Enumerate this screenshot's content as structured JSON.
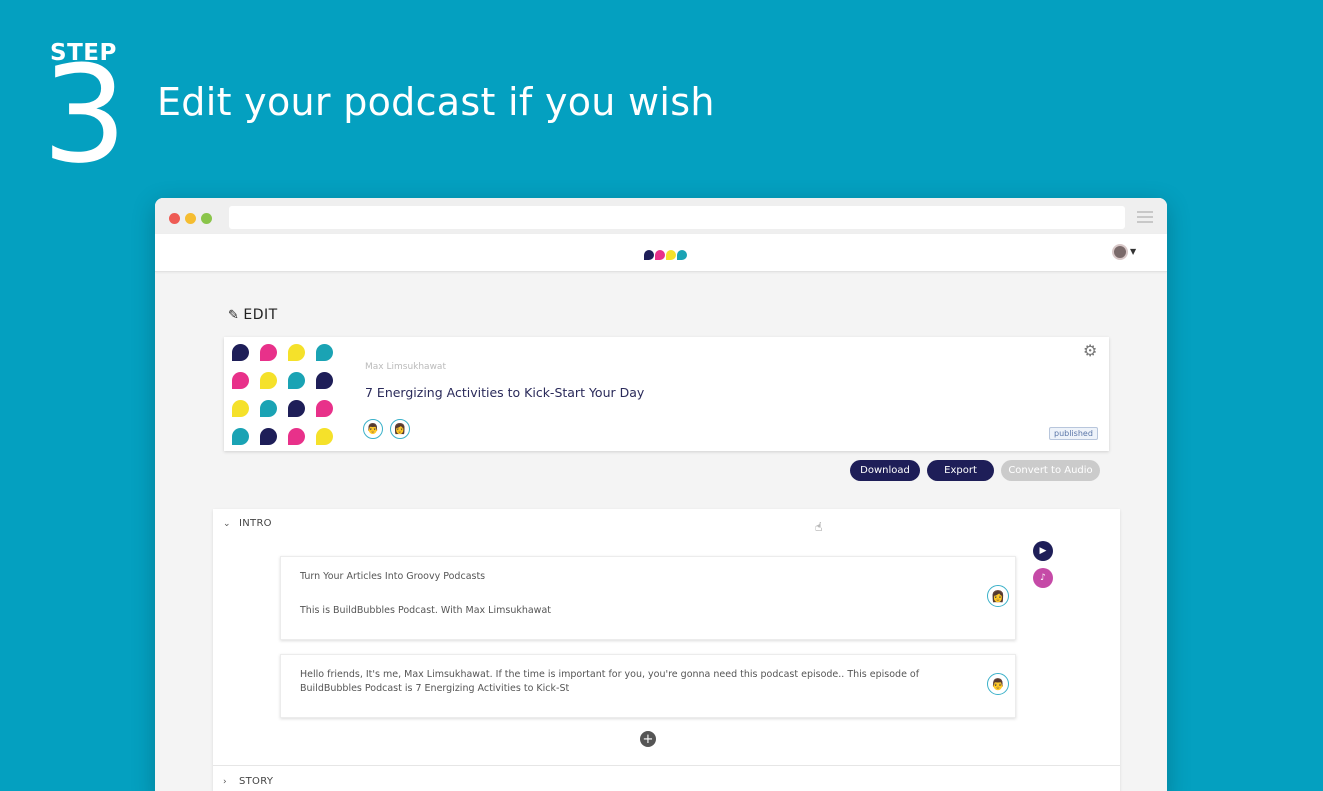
{
  "banner": {
    "step_label": "STEP",
    "step_number": "3",
    "title": "Edit your podcast if you wish"
  },
  "colors": {
    "background": "#04a0c0",
    "navy": "#1e1e58",
    "pink": "#e8318a",
    "yellow": "#f5e12a",
    "teal": "#1aa3b4"
  },
  "logo_colors": [
    "#1e1e58",
    "#e8318a",
    "#f5e12a",
    "#1aa3b4"
  ],
  "bubble_colors": [
    "#1e1e58",
    "#e8318a",
    "#f5e12a",
    "#1aa3b4",
    "#e8318a",
    "#f5e12a",
    "#1aa3b4",
    "#1e1e58",
    "#f5e12a",
    "#1aa3b4",
    "#1e1e58",
    "#e8318a",
    "#1aa3b4",
    "#1e1e58",
    "#e8318a",
    "#f5e12a"
  ],
  "page": {
    "heading": "EDIT",
    "heading_icon": "pencil-icon"
  },
  "podcast": {
    "author": "Max Limsukhawat",
    "title": "7 Energizing Activities to Kick-Start Your Day",
    "status": "published",
    "hosts": [
      "host-avatar-male",
      "host-avatar-female"
    ]
  },
  "actions": {
    "download": "Download",
    "export": "Export",
    "convert": "Convert to Audio"
  },
  "sections": {
    "intro": "INTRO",
    "story": "STORY",
    "blocks": [
      {
        "line1": "Turn Your Articles Into Groovy Podcasts",
        "line2": "This is BuildBubbles Podcast. With Max Limsukhawat"
      },
      {
        "line1": "Hello friends, It's me, Max Limsukhawat. If the time is important for you, you're gonna need this podcast episode.. This episode of BuildBubbles Podcast is 7 Energizing Activities to Kick-St"
      }
    ]
  }
}
